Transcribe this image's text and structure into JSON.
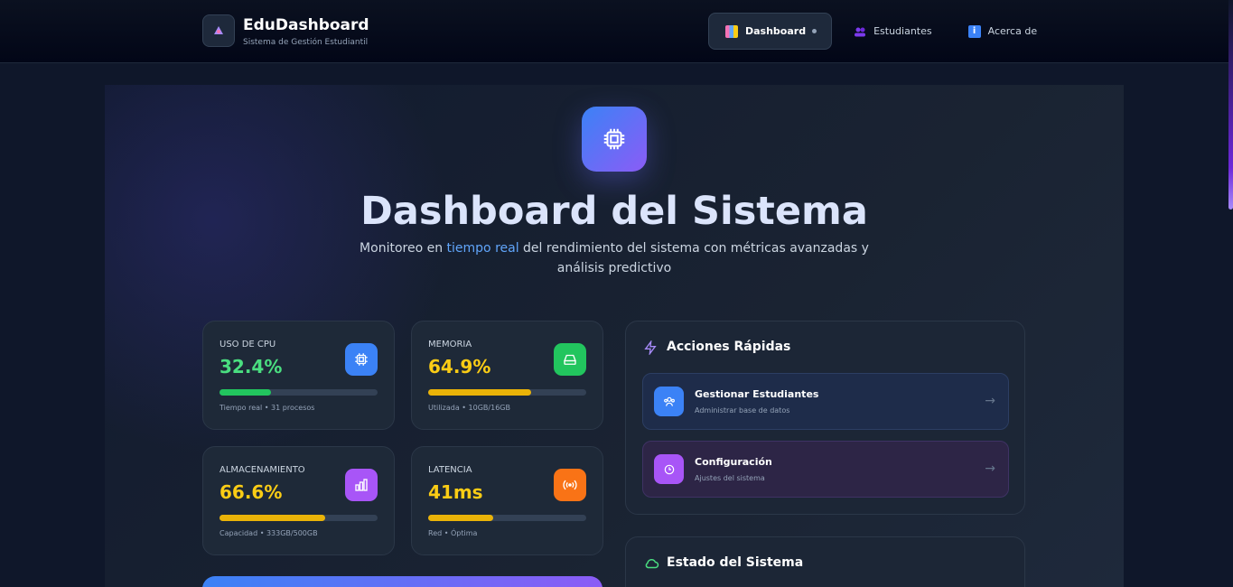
{
  "brand": {
    "title": "EduDashboard",
    "subtitle": "Sistema de Gestión Estudiantil"
  },
  "nav": {
    "items": [
      {
        "label": "Dashboard",
        "icon": "chart-icon",
        "active": true
      },
      {
        "label": "Estudiantes",
        "icon": "users-icon",
        "active": false
      },
      {
        "label": "Acerca de",
        "icon": "info-icon",
        "active": false
      }
    ]
  },
  "hero": {
    "title": "Dashboard del Sistema",
    "subtitle_pre": "Monitoreo en ",
    "subtitle_highlight": "tiempo real",
    "subtitle_post": " del rendimiento del sistema con métricas avanzadas y análisis predictivo"
  },
  "metrics": [
    {
      "label": "USO DE CPU",
      "value": "32.4%",
      "fill_pct": 32.4,
      "foot": "Tiempo real • 31 procesos",
      "value_color": "#4ade80",
      "bar_color": "#22c55e",
      "icon": "cpu-icon",
      "icon_bg": "#3b82f6"
    },
    {
      "label": "MEMORIA",
      "value": "64.9%",
      "fill_pct": 64.9,
      "foot": "Utilizada • 10GB/16GB",
      "value_color": "#facc15",
      "bar_color": "#eab308",
      "icon": "drive-icon",
      "icon_bg": "#22c55e"
    },
    {
      "label": "ALMACENAMIENTO",
      "value": "66.6%",
      "fill_pct": 66.6,
      "foot": "Capacidad • 333GB/500GB",
      "value_color": "#facc15",
      "bar_color": "#eab308",
      "icon": "bar-chart-icon",
      "icon_bg": "#a855f7"
    },
    {
      "label": "LATENCIA",
      "value": "41ms",
      "fill_pct": 41,
      "foot": "Red • Óptima",
      "value_color": "#facc15",
      "bar_color": "#eab308",
      "icon": "signal-icon",
      "icon_bg": "#f97316"
    }
  ],
  "quick_actions": {
    "title": "Acciones Rápidas",
    "items": [
      {
        "title": "Gestionar Estudiantes",
        "subtitle": "Administrar base de datos",
        "icon": "users-icon"
      },
      {
        "title": "Configuración",
        "subtitle": "Ajustes del sistema",
        "icon": "clock-icon"
      }
    ]
  },
  "system_status": {
    "title": "Estado del Sistema",
    "icon": "cloud-icon"
  },
  "colors": {
    "accent_blue": "#3b82f6",
    "accent_purple": "#8b5cf6",
    "highlight": "#60a5fa"
  }
}
